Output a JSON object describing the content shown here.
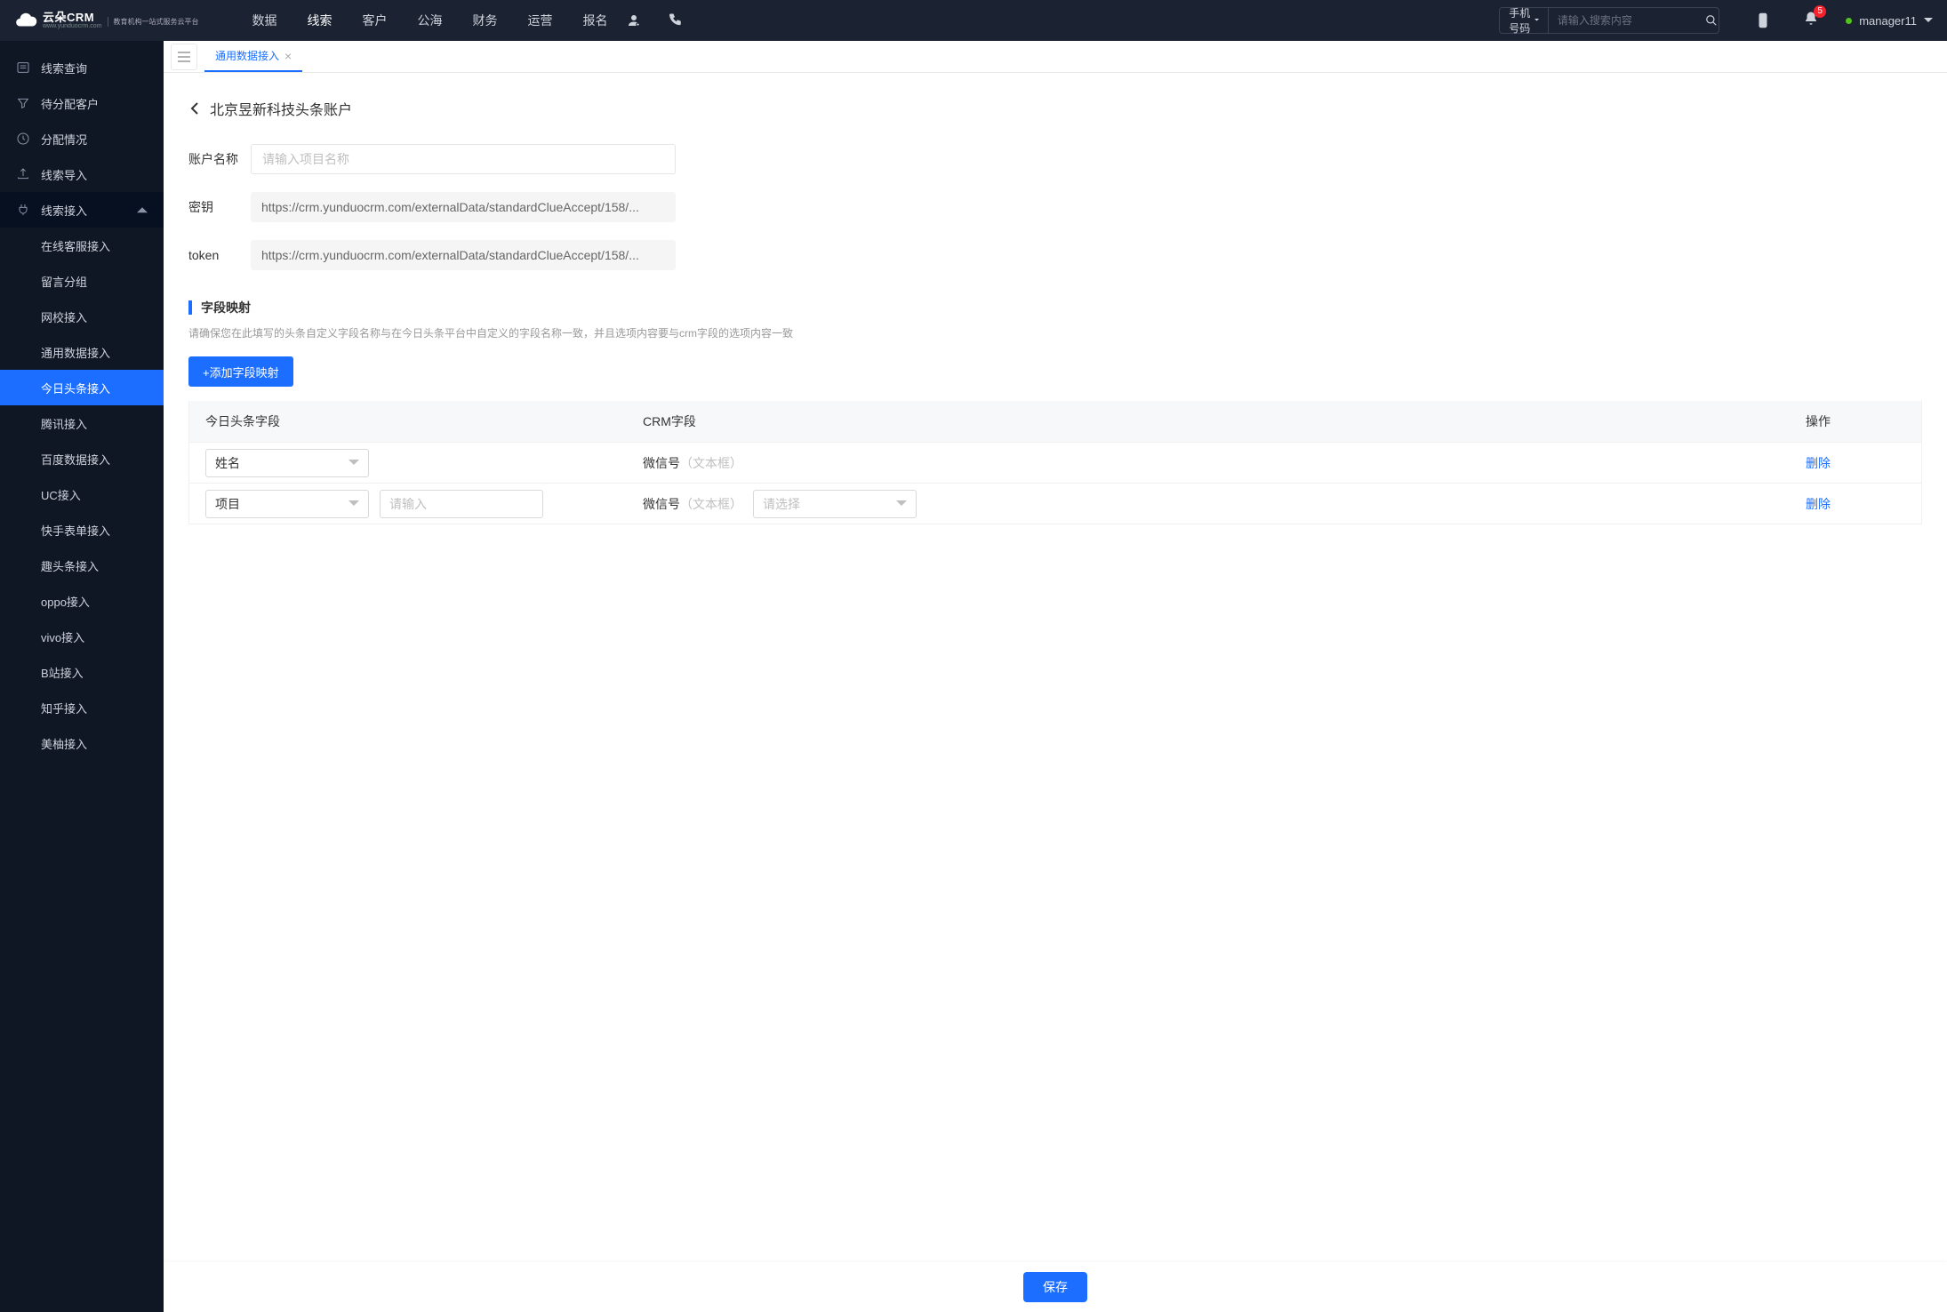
{
  "brand": {
    "name": "云朵CRM",
    "domain": "www.yunduocrm.com",
    "tagline": "教育机构一站式服务云平台"
  },
  "nav": {
    "items": [
      "数据",
      "线索",
      "客户",
      "公海",
      "财务",
      "运营",
      "报名"
    ],
    "activeIndex": 1
  },
  "search": {
    "select": "手机号码",
    "placeholder": "请输入搜索内容"
  },
  "notifications": {
    "count": "5"
  },
  "user": {
    "name": "manager11"
  },
  "sidebar": {
    "items": [
      {
        "label": "线索查询",
        "icon": "list"
      },
      {
        "label": "待分配客户",
        "icon": "filter"
      },
      {
        "label": "分配情况",
        "icon": "clock"
      },
      {
        "label": "线索导入",
        "icon": "upload"
      }
    ],
    "group": {
      "label": "线索接入",
      "icon": "plug",
      "expanded": true
    },
    "subs": [
      "在线客服接入",
      "留言分组",
      "网校接入",
      "通用数据接入",
      "今日头条接入",
      "腾讯接入",
      "百度数据接入",
      "UC接入",
      "快手表单接入",
      "趣头条接入",
      "oppo接入",
      "vivo接入",
      "B站接入",
      "知乎接入",
      "美柚接入"
    ],
    "activeSubIndex": 4
  },
  "tabs": {
    "items": [
      "通用数据接入"
    ],
    "activeIndex": 0
  },
  "page": {
    "title": "北京昱新科技头条账户",
    "accountNameLabel": "账户名称",
    "accountNamePlaceholder": "请输入项目名称",
    "secretLabel": "密钥",
    "secretValue": "https://crm.yunduocrm.com/externalData/standardClueAccept/158/...",
    "tokenLabel": "token",
    "tokenValue": "https://crm.yunduocrm.com/externalData/standardClueAccept/158/...",
    "mappingTitle": "字段映射",
    "mappingHint": "请确保您在此填写的头条自定义字段名称与在今日头条平台中自定义的字段名称一致，并且选项内容要与crm字段的选项内容一致",
    "addBtn": "+添加字段映射",
    "saveBtn": "保存",
    "table": {
      "headers": [
        "今日头条字段",
        "CRM字段",
        "操作"
      ],
      "deleteLabel": "删除",
      "rows": [
        {
          "tt": "姓名",
          "ttInput": "",
          "crm": "微信号",
          "crmType": "（文本框）",
          "crmSelect": "",
          "hasExtras": false
        },
        {
          "tt": "项目",
          "ttInputPh": "请输入",
          "crm": "微信号",
          "crmType": "（文本框）",
          "crmSelectPh": "请选择",
          "hasExtras": true
        }
      ]
    }
  }
}
